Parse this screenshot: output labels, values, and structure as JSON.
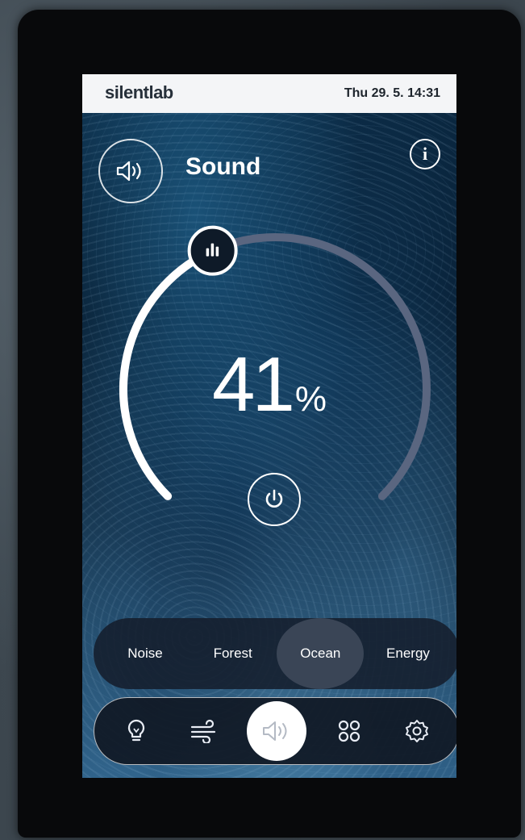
{
  "header": {
    "brand": "silentlab",
    "datetime": "Thu 29. 5. 14:31"
  },
  "page": {
    "title": "Sound",
    "sound_icon": "speaker-icon",
    "info_label": "i"
  },
  "dial": {
    "level_percent": 41,
    "value": "41",
    "unit": "%",
    "handle_icon": "equalizer-icon",
    "power_icon": "power-icon"
  },
  "modes": {
    "items": [
      {
        "label": "Noise",
        "active": false
      },
      {
        "label": "Forest",
        "active": false
      },
      {
        "label": "Ocean",
        "active": true
      },
      {
        "label": "Energy",
        "active": false
      }
    ]
  },
  "nav": {
    "items": [
      {
        "icon": "lightbulb-icon",
        "active": false
      },
      {
        "icon": "wind-icon",
        "active": false
      },
      {
        "icon": "speaker-icon",
        "active": true
      },
      {
        "icon": "apps-grid-icon",
        "active": false
      },
      {
        "icon": "gear-icon",
        "active": false
      }
    ]
  },
  "colors": {
    "accent": "#ffffff",
    "track": "#5a6680",
    "mode_active_bg": "#3a4556"
  }
}
